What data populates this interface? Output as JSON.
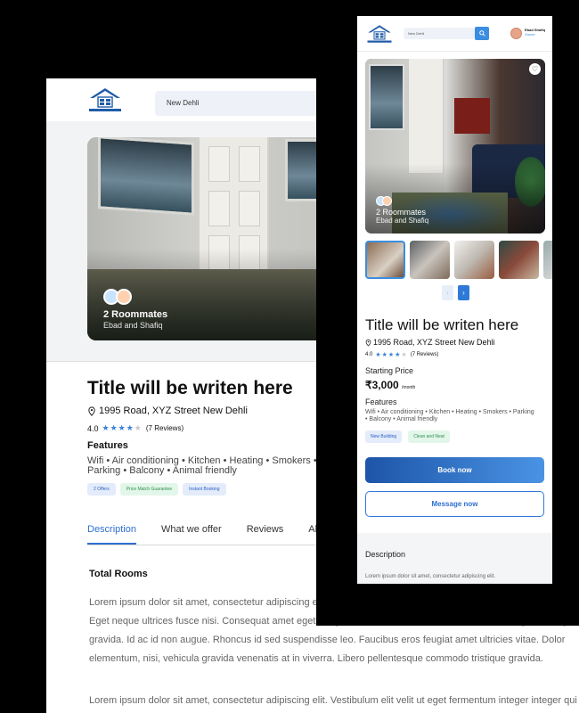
{
  "desktop": {
    "search_value": "New Dehli",
    "hero": {
      "roommates": "2 Roommates",
      "names": "Ebad and Shafiq"
    },
    "title": "Title will be writen here",
    "address": "1995 Road, XYZ Street New Dehli",
    "rating": "4.0",
    "reviews": "(7 Reviews)",
    "features_heading": "Features",
    "features": "Wifi • Air conditioning • Kitchen • Heating • Smokers • Parking • Balcony • Animal friendly",
    "tags": [
      "2 Offers",
      "Price Match Guarantee",
      "Instant Booking"
    ],
    "tabs": [
      "Description",
      "What we offer",
      "Reviews",
      "Abo"
    ],
    "section_heading": "Total Rooms",
    "lorem1": "Lorem ipsum dolor sit amet, consectetur adipiscing elit. Vestibulum elit velit ut eget fermentum integer. Quis eget. Eget neque ultrices fusce nisi. Consequat amet eget integer. Sit amet nibh a, molestie tincidunt in dignissim eget gravida. Id ac id non augue. Rhoncus id sed suspendisse leo. Faucibus eros feugiat amet ultricies vitae. Dolor elementum, nisi, vehicula gravida venenatis at in viverra. Libero pellentesque commodo tristique gravida.",
    "lorem2": "Lorem ipsum dolor sit amet, consectetur adipiscing elit. Vestibulum elit velit ut eget fermentum integer integer qui"
  },
  "mobile": {
    "search_value": "New Dehli",
    "search_icon": "magnifier-icon",
    "user_name": "Ebad Shafiq",
    "user_role": "Owner",
    "hero": {
      "roommates": "2 Roommates",
      "names": "Ebad and Shafiq"
    },
    "prev_label": "‹",
    "next_label": "›",
    "title": "Title will be writen here",
    "address": "1995 Road, XYZ Street New Dehli",
    "rating": "4.0",
    "reviews": "(7 Reviews)",
    "starting_price_label": "Starting Price",
    "price": "₹3,000",
    "price_unit": "/month",
    "features_heading": "Features",
    "features": "Wifi • Air conditioning • Kitchen • Heating • Smokers • Parking • Balcony • Animal friendly",
    "tags": [
      "New Building",
      "Clean and Neat"
    ],
    "book_label": "Book now",
    "message_label": "Message now",
    "description_heading": "Description",
    "lorem": "Lorem ipsum dolor sit amet, consectetur adipiscing elit."
  },
  "colors": {
    "accent": "#2f7ad8",
    "tag_blue_bg": "#e4ecfb",
    "tag_green_bg": "#e3f6ea"
  }
}
